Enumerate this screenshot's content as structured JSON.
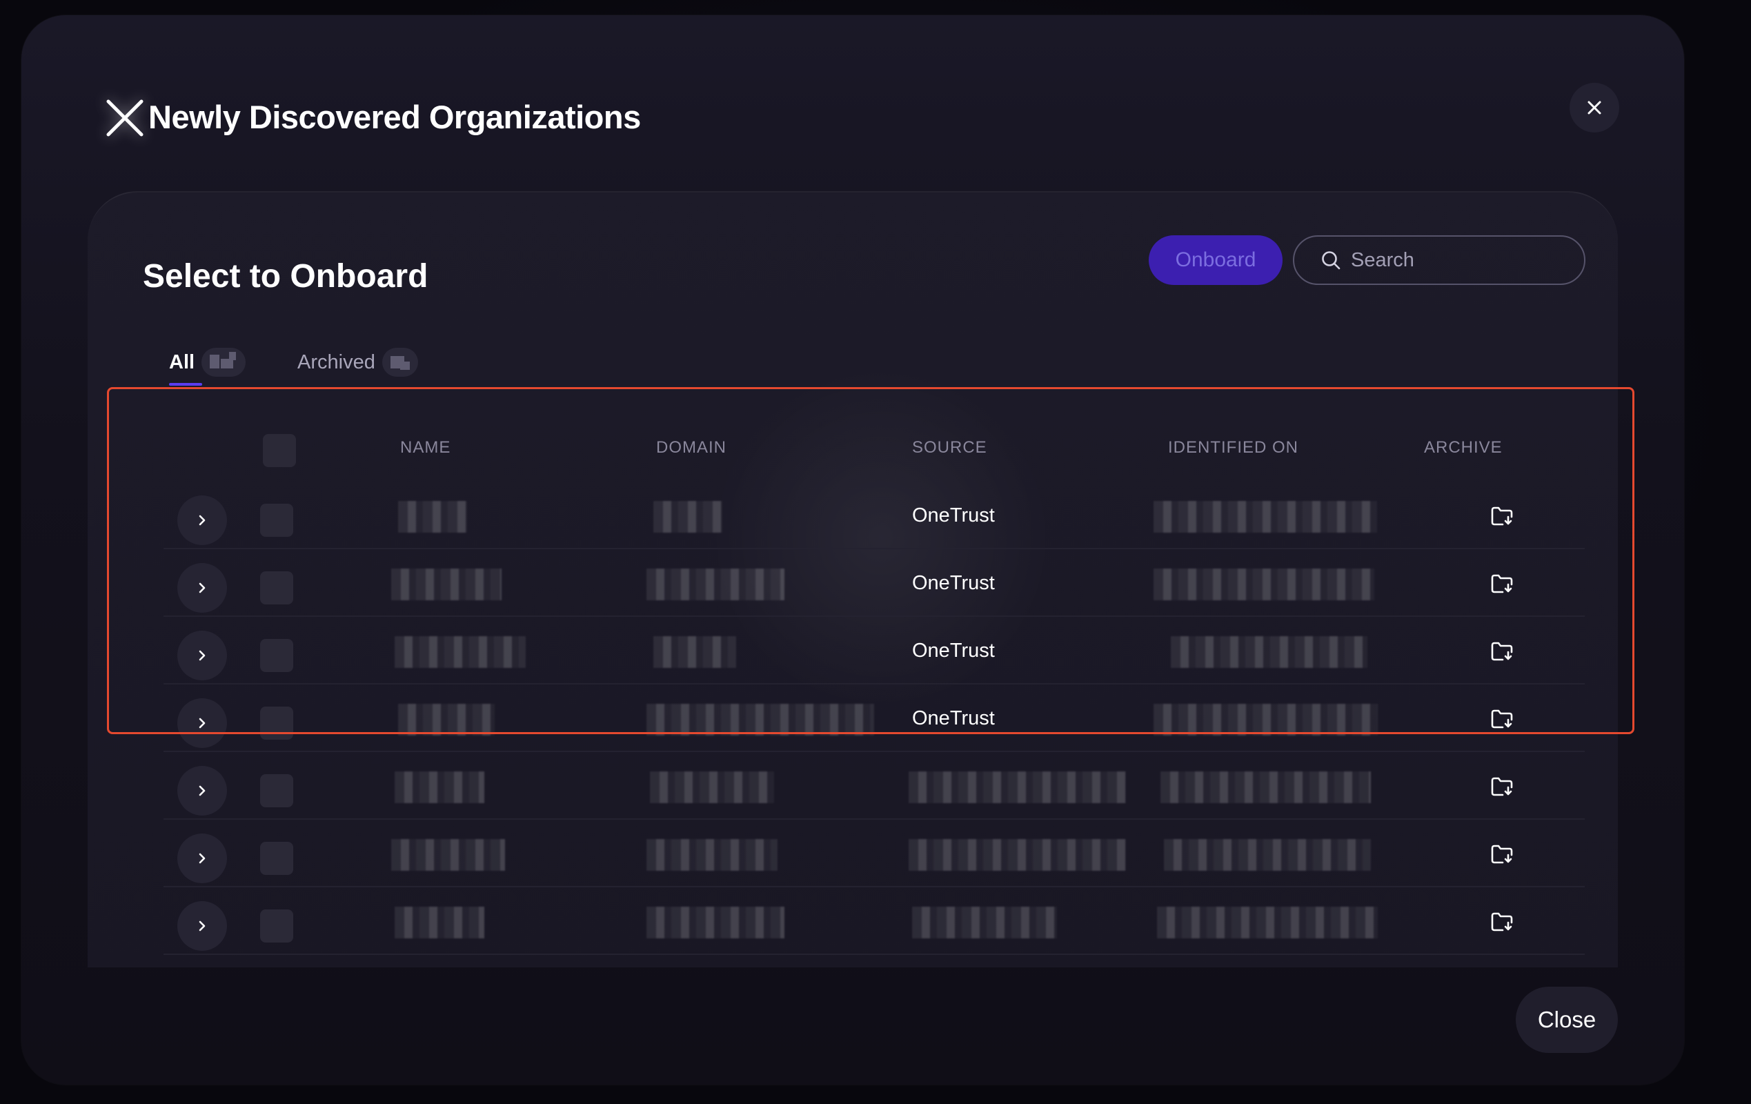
{
  "modal": {
    "title": "Newly Discovered Organizations",
    "close_label": "Close"
  },
  "panel": {
    "title": "Select to Onboard",
    "onboard_label": "Onboard",
    "search_placeholder": "Search"
  },
  "tabs": [
    {
      "label": "All",
      "active": true
    },
    {
      "label": "Archived",
      "active": false
    }
  ],
  "table": {
    "columns": [
      "NAME",
      "DOMAIN",
      "SOURCE",
      "IDENTIFIED ON",
      "ARCHIVE"
    ],
    "rows": [
      {
        "source": "OneTrust"
      },
      {
        "source": "OneTrust"
      },
      {
        "source": "OneTrust"
      },
      {
        "source": "OneTrust"
      },
      {
        "source": ""
      },
      {
        "source": ""
      },
      {
        "source": ""
      }
    ]
  },
  "colors": {
    "accent": "#3c1fb0",
    "tab_indicator": "#5a3df0",
    "highlight": "#e5492f"
  },
  "icons": {
    "logo": "x-logo-icon",
    "close": "close-icon",
    "search": "search-icon",
    "expand": "chevron-right-icon",
    "archive": "folder-archive-icon"
  }
}
